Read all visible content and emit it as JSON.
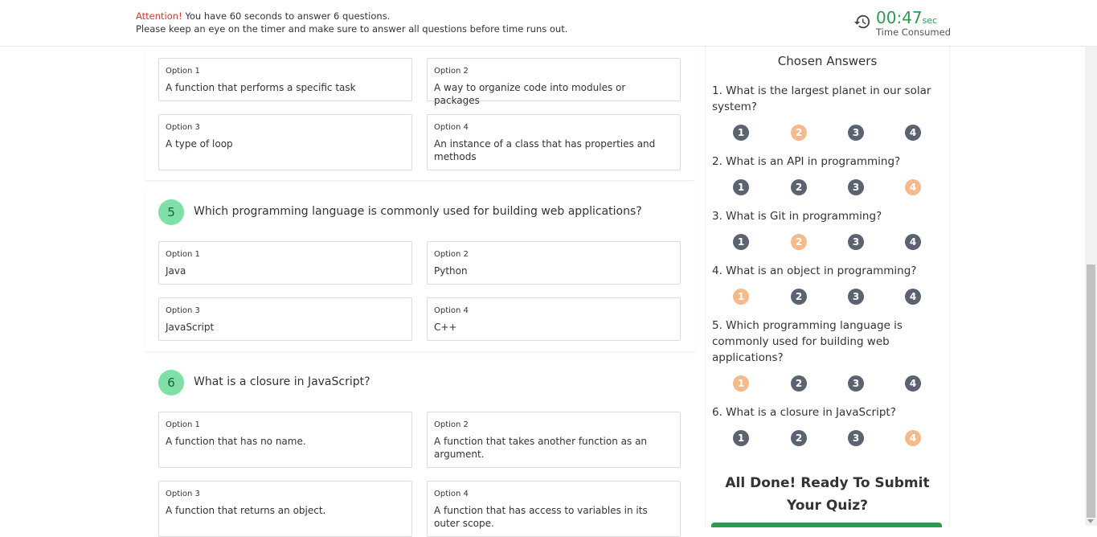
{
  "header": {
    "attention_label": "Attention!",
    "attention_text": "You have 60 seconds to answer 6 questions.",
    "attention_line2": "Please keep an eye on the timer and make sure to answer all questions before time runs out.",
    "timer_value": "00:47",
    "timer_unit": "sec",
    "timer_label": "Time Consumed",
    "timer_icon": "history-clock-icon"
  },
  "questions": [
    {
      "options": [
        {
          "label": "Option 1",
          "text": "A function that performs a specific task"
        },
        {
          "label": "Option 2",
          "text": "A way to organize code into modules or packages"
        },
        {
          "label": "Option 3",
          "text": "A type of loop"
        },
        {
          "label": "Option 4",
          "text": "An instance of a class that has properties and methods"
        }
      ]
    },
    {
      "number": "5",
      "text": "Which programming language is commonly used for building web applications?",
      "options": [
        {
          "label": "Option 1",
          "text": "Java"
        },
        {
          "label": "Option 2",
          "text": "Python"
        },
        {
          "label": "Option 3",
          "text": "JavaScript"
        },
        {
          "label": "Option 4",
          "text": "C++"
        }
      ]
    },
    {
      "number": "6",
      "text": "What is a closure in JavaScript?",
      "options": [
        {
          "label": "Option 1",
          "text": "A function that has no name."
        },
        {
          "label": "Option 2",
          "text": "A function that takes another function as an argument."
        },
        {
          "label": "Option 3",
          "text": "A function that returns an object."
        },
        {
          "label": "Option 4",
          "text": "A function that has access to variables in its outer scope."
        }
      ]
    }
  ],
  "chosen": {
    "title": "Chosen Answers",
    "items": [
      {
        "text": "1. What is the largest planet in our solar system?",
        "options": [
          "1",
          "2",
          "3",
          "4"
        ],
        "selected": "2"
      },
      {
        "text": "2. What is an API in programming?",
        "options": [
          "1",
          "2",
          "3",
          "4"
        ],
        "selected": "4"
      },
      {
        "text": "3. What is Git in programming?",
        "options": [
          "1",
          "2",
          "3",
          "4"
        ],
        "selected": "2"
      },
      {
        "text": "4. What is an object in programming?",
        "options": [
          "1",
          "2",
          "3",
          "4"
        ],
        "selected": "1"
      },
      {
        "text": "5. Which programming language is commonly used for building web applications?",
        "options": [
          "1",
          "2",
          "3",
          "4"
        ],
        "selected": "1"
      },
      {
        "text": "6. What is a closure in JavaScript?",
        "options": [
          "1",
          "2",
          "3",
          "4"
        ],
        "selected": "4"
      }
    ],
    "done_text": "All Done! Ready To Submit Your Quiz?"
  },
  "colors": {
    "timer_green": "#2e9a4f",
    "attention_red": "#d9342b",
    "question_badge": "#7ee0a6",
    "dot_default": "#5b6270",
    "dot_selected": "#f6b98b"
  }
}
